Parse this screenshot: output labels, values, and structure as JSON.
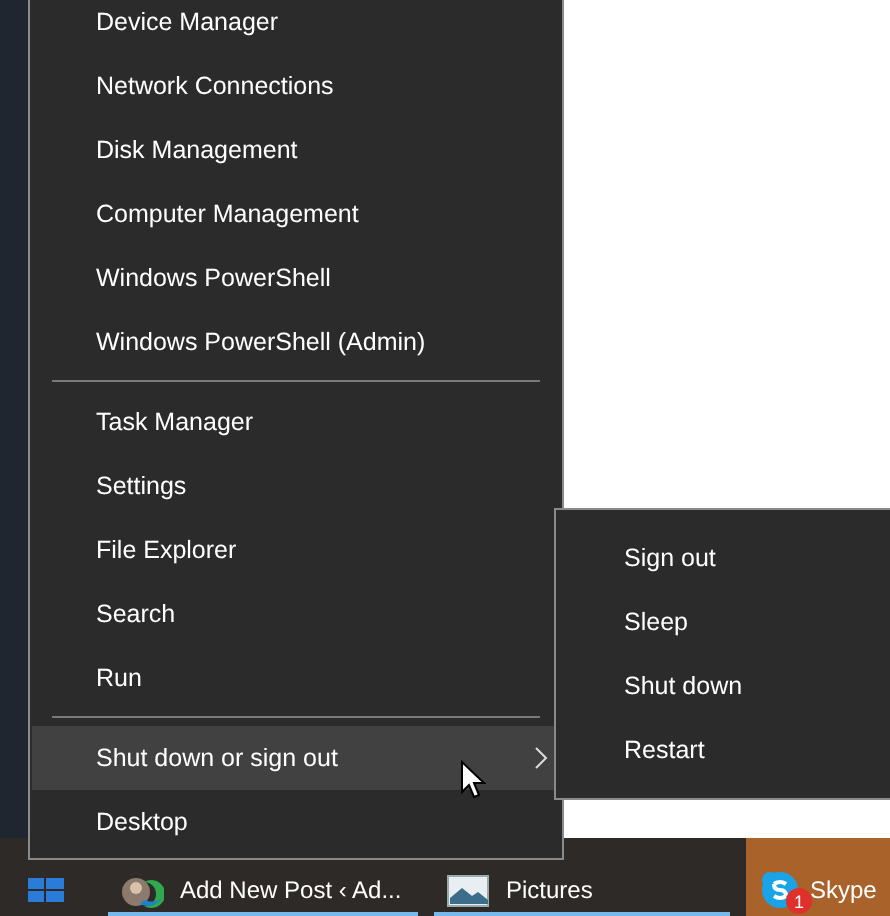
{
  "menu": {
    "groups": [
      [
        {
          "label": "Device Manager",
          "selected": false,
          "has_submenu": false
        },
        {
          "label": "Network Connections",
          "selected": false,
          "has_submenu": false
        },
        {
          "label": "Disk Management",
          "selected": false,
          "has_submenu": false
        },
        {
          "label": "Computer Management",
          "selected": false,
          "has_submenu": false
        },
        {
          "label": "Windows PowerShell",
          "selected": false,
          "has_submenu": false
        },
        {
          "label": "Windows PowerShell (Admin)",
          "selected": false,
          "has_submenu": false
        }
      ],
      [
        {
          "label": "Task Manager",
          "selected": false,
          "has_submenu": false
        },
        {
          "label": "Settings",
          "selected": false,
          "has_submenu": false
        },
        {
          "label": "File Explorer",
          "selected": false,
          "has_submenu": false
        },
        {
          "label": "Search",
          "selected": false,
          "has_submenu": false
        },
        {
          "label": "Run",
          "selected": false,
          "has_submenu": false
        }
      ],
      [
        {
          "label": "Shut down or sign out",
          "selected": true,
          "has_submenu": true
        },
        {
          "label": "Desktop",
          "selected": false,
          "has_submenu": false
        }
      ]
    ]
  },
  "submenu": {
    "items": [
      {
        "label": "Sign out"
      },
      {
        "label": "Sleep"
      },
      {
        "label": "Shut down"
      },
      {
        "label": "Restart"
      }
    ]
  },
  "taskbar": {
    "items": [
      {
        "kind": "browser",
        "label": "Add New Post ‹ Ad...",
        "attention": false
      },
      {
        "kind": "folder",
        "label": "Pictures",
        "attention": false
      },
      {
        "kind": "chat",
        "label": "Skype",
        "attention": true,
        "badge": "1"
      }
    ]
  }
}
